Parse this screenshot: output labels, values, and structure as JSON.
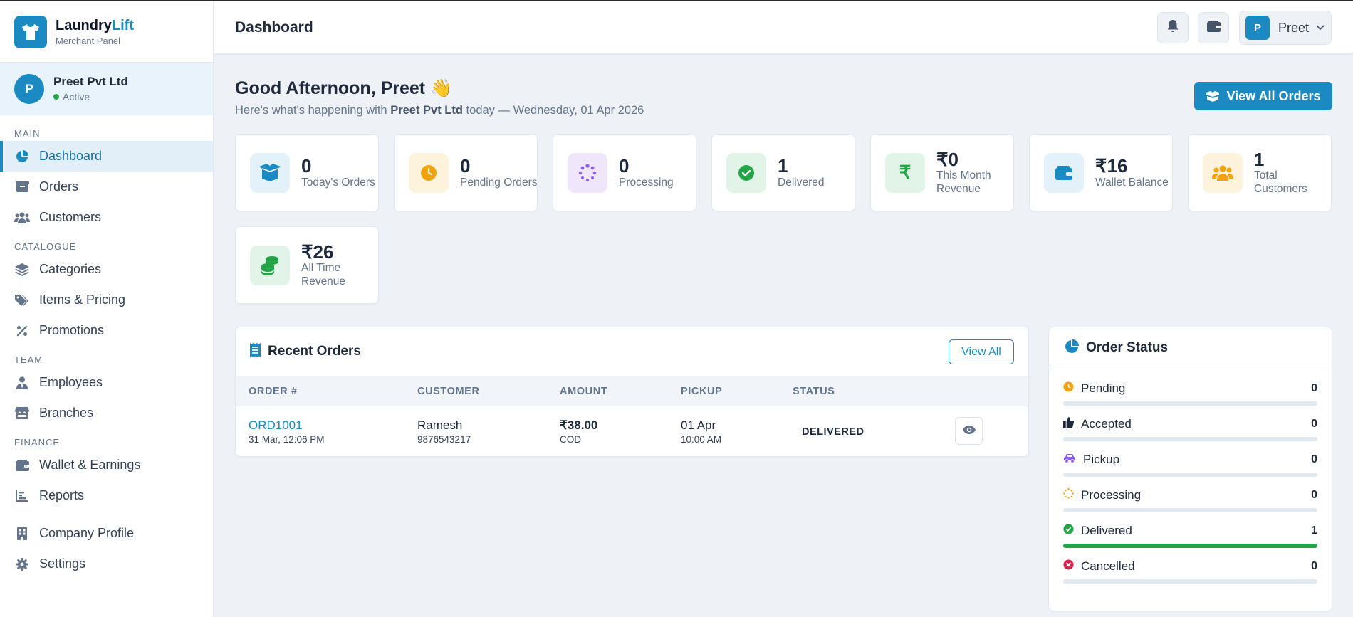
{
  "brand": {
    "name_prefix": "Laundry",
    "name_accent": "Lift",
    "subtitle": "Merchant Panel"
  },
  "merchant": {
    "initial": "P",
    "name": "Preet Pvt Ltd",
    "status": "Active"
  },
  "nav": {
    "main_label": "MAIN",
    "dashboard": "Dashboard",
    "orders": "Orders",
    "customers": "Customers",
    "catalogue_label": "CATALOGUE",
    "categories": "Categories",
    "items_pricing": "Items & Pricing",
    "promotions": "Promotions",
    "team_label": "TEAM",
    "employees": "Employees",
    "branches": "Branches",
    "finance_label": "FINANCE",
    "wallet": "Wallet & Earnings",
    "reports": "Reports",
    "company_profile": "Company Profile",
    "settings": "Settings"
  },
  "header": {
    "title": "Dashboard",
    "user_initial": "P",
    "user_name": "Preet"
  },
  "greeting": {
    "title": "Good Afternoon, Preet 👋",
    "sub_prefix": "Here's what's happening with ",
    "company": "Preet Pvt Ltd",
    "sub_suffix": " today — Wednesday, 01 Apr 2026",
    "view_all_orders": "View All Orders"
  },
  "stats": {
    "todays_orders": {
      "value": "0",
      "label": "Today's Orders"
    },
    "pending_orders": {
      "value": "0",
      "label": "Pending Orders"
    },
    "processing": {
      "value": "0",
      "label": "Processing"
    },
    "delivered": {
      "value": "1",
      "label": "Delivered"
    },
    "month_revenue": {
      "value": "₹0",
      "label": "This Month Revenue"
    },
    "wallet_balance": {
      "value": "₹16",
      "label": "Wallet Balance"
    },
    "total_customers": {
      "value": "1",
      "label": "Total Customers"
    },
    "all_time_revenue": {
      "value": "₹26",
      "label": "All Time Revenue"
    }
  },
  "recent_orders": {
    "title": "Recent Orders",
    "view_all": "View All",
    "columns": {
      "order": "ORDER #",
      "customer": "CUSTOMER",
      "amount": "AMOUNT",
      "pickup": "PICKUP",
      "status": "STATUS"
    },
    "rows": [
      {
        "order_id": "ORD1001",
        "date": "31 Mar, 12:06 PM",
        "customer": "Ramesh",
        "phone": "9876543217",
        "amount": "₹38.00",
        "payment": "COD",
        "pickup_date": "01 Apr",
        "pickup_time": "10:00 AM",
        "status": "DELIVERED"
      }
    ]
  },
  "order_status": {
    "title": "Order Status",
    "items": [
      {
        "label": "Pending",
        "count": "0",
        "fraction": 0,
        "icon": "clock-icon",
        "color": "#f0a30a"
      },
      {
        "label": "Accepted",
        "count": "0",
        "fraction": 0,
        "icon": "thumbs-up-icon",
        "color": "#1e293b"
      },
      {
        "label": "Pickup",
        "count": "0",
        "fraction": 0,
        "icon": "car-icon",
        "color": "#8b5cf6"
      },
      {
        "label": "Processing",
        "count": "0",
        "fraction": 0,
        "icon": "spinner-icon",
        "color": "#f0a30a"
      },
      {
        "label": "Delivered",
        "count": "1",
        "fraction": 1,
        "icon": "check-circle-icon",
        "color": "#22a447"
      },
      {
        "label": "Cancelled",
        "count": "0",
        "fraction": 0,
        "icon": "x-circle-icon",
        "color": "#e11d48"
      }
    ]
  },
  "colors": {
    "primary": "#1b8ac2",
    "success": "#22a447",
    "warning": "#f0a30a",
    "purple": "#8b5cf6",
    "danger": "#e11d48"
  }
}
